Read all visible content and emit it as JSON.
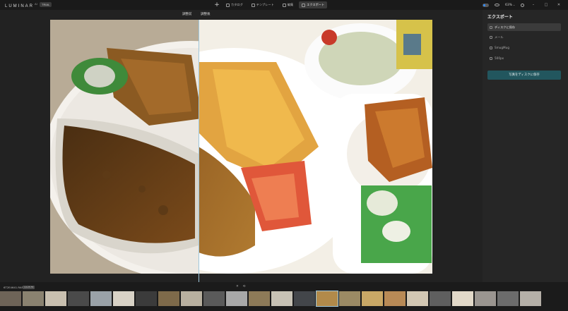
{
  "app": {
    "logo": "LUMINAR",
    "logo_version": "AI",
    "badge": "TRIAL"
  },
  "nav": {
    "tabs": [
      {
        "label": "カタログ",
        "icon": "folder-icon",
        "active": false
      },
      {
        "label": "テンプレート",
        "icon": "template-icon",
        "active": false
      },
      {
        "label": "編集",
        "icon": "edit-icon",
        "active": false
      },
      {
        "label": "エクスポート",
        "icon": "export-icon",
        "active": true
      }
    ]
  },
  "toolbar_right": {
    "zoom": "63%",
    "minimize": "–",
    "maximize": "□",
    "close": "✕"
  },
  "canvas": {
    "before_label": "調整前",
    "after_label": "調整後"
  },
  "export_panel": {
    "title": "エクスポート",
    "items": [
      {
        "label": "ディスクに保存",
        "icon": "folder-icon",
        "active": true
      },
      {
        "label": "メール",
        "icon": "mail-icon",
        "active": false
      },
      {
        "label": "SmugMug",
        "icon": "smugmug-icon",
        "active": false
      },
      {
        "label": "500px",
        "icon": "500px-icon",
        "active": false
      }
    ],
    "button": "写真をディスクに保存"
  },
  "filmstrip": {
    "filename": "6T2E4641.RAF",
    "file_tag": "1/125 F8",
    "nav_prev": "✕",
    "nav_next": "⟲",
    "thumb_colors": [
      "#6e6458",
      "#8a8270",
      "#c9c0b0",
      "#4a4a4a",
      "#9aa2a8",
      "#d8d2c6",
      "#3b3b3b",
      "#7e6a4a",
      "#b8b0a0",
      "#5a5a5a",
      "#a8a8a8",
      "#8d7a58",
      "#c7c2b5",
      "#43464a",
      "#b28a4a",
      "#9b8a64",
      "#c9a866",
      "#b88a56",
      "#d2c7b3",
      "#5f5f5f",
      "#e2d9c9",
      "#9a9590",
      "#6c6c6c",
      "#b5b0a8"
    ]
  }
}
